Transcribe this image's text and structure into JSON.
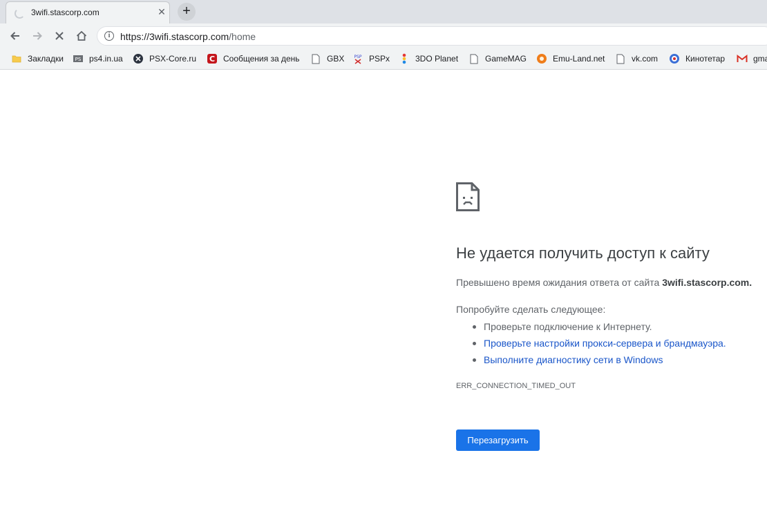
{
  "tab": {
    "title": "3wifi.stascorp.com",
    "close_glyph": "✕",
    "new_tab_glyph": "+",
    "loading_icon": "spinner-icon"
  },
  "toolbar": {
    "back_icon": "back-arrow-icon",
    "forward_icon": "forward-arrow-icon",
    "stop_icon": "stop-icon",
    "home_icon": "home-icon",
    "info_glyph": "i",
    "url_origin": "https://3wifi.stascorp.com",
    "url_path": "/home"
  },
  "bookmarks": [
    {
      "label": "Закладки",
      "icon": "folder-icon"
    },
    {
      "label": "ps4.in.ua",
      "icon": "ps4-icon"
    },
    {
      "label": "PSX-Core.ru",
      "icon": "psx-core-icon"
    },
    {
      "label": "Сообщения за день",
      "icon": "red-c-icon"
    },
    {
      "label": "GBX",
      "icon": "page-icon"
    },
    {
      "label": "PSPx",
      "icon": "pspx-icon"
    },
    {
      "label": "3DO Planet",
      "icon": "3do-icon"
    },
    {
      "label": "GameMAG",
      "icon": "page-icon"
    },
    {
      "label": "Emu-Land.net",
      "icon": "emu-land-icon"
    },
    {
      "label": "vk.com",
      "icon": "page-icon"
    },
    {
      "label": "Кинотетар",
      "icon": "globe-icon"
    },
    {
      "label": "gma",
      "icon": "gmail-icon"
    }
  ],
  "error": {
    "icon": "sad-page-icon",
    "heading": "Не удается получить доступ к сайту",
    "desc_prefix": "Превышено время ожидания ответа от сайта ",
    "desc_host": "3wifi.stascorp.com.",
    "try_label": "Попробуйте сделать следующее:",
    "suggestions": [
      "Проверьте подключение к Интернету.",
      "Проверьте настройки прокси-сервера и брандмауэра.",
      "Выполните диагностику сети в Windows"
    ],
    "code": "ERR_CONNECTION_TIMED_OUT",
    "reload_label": "Перезагрузить"
  },
  "colors": {
    "link": "#1a56c9",
    "button": "#1a73e8",
    "toolbar_bg": "#f1f3f4",
    "tabstrip_bg": "#dee1e6"
  }
}
